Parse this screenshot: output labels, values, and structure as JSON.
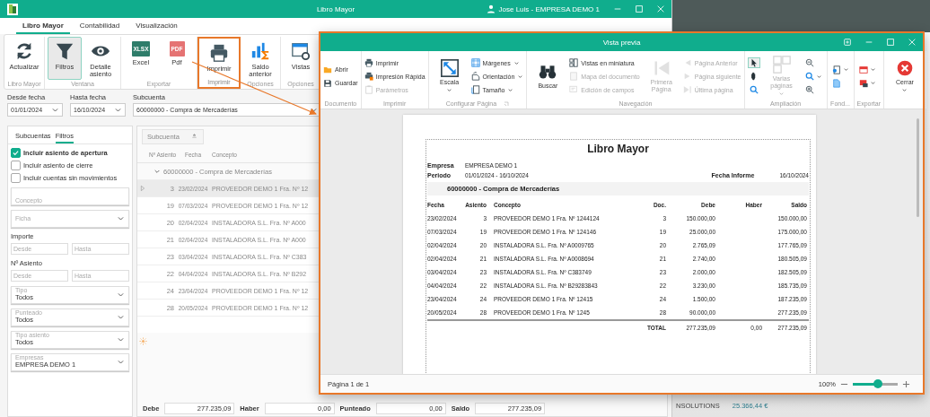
{
  "main_window": {
    "title": "Libro Mayor",
    "user": "Jose Luis - EMPRESA DEMO 1"
  },
  "ribbon_tabs": [
    {
      "label": "Libro Mayor",
      "selected": true
    },
    {
      "label": "Contabilidad",
      "selected": false
    },
    {
      "label": "Visualización",
      "selected": false
    }
  ],
  "ribbon_groups": [
    {
      "label": "Libro Mayor",
      "highlighted": false,
      "buttons": [
        {
          "label": "Actualizar",
          "selected": false
        }
      ]
    },
    {
      "label": "Ventana",
      "highlighted": false,
      "buttons": [
        {
          "label": "Filtros",
          "selected": true
        },
        {
          "label": "Detalle asiento",
          "selected": false
        }
      ]
    },
    {
      "label": "Exportar",
      "highlighted": false,
      "buttons": [
        {
          "label": "Excel",
          "selected": false,
          "badge": "XLSX"
        },
        {
          "label": "Pdf",
          "selected": false,
          "badge": "PDF"
        }
      ]
    },
    {
      "label": "Imprimir",
      "highlighted": true,
      "buttons": [
        {
          "label": "Imprimir",
          "selected": false
        }
      ]
    },
    {
      "label": "Opciones",
      "highlighted": false,
      "buttons": [
        {
          "label": "Saldo anterior",
          "selected": false
        }
      ]
    },
    {
      "label": "Opciones",
      "highlighted": false,
      "buttons": [
        {
          "label": "Vistas",
          "selected": false
        }
      ]
    }
  ],
  "filters": [
    {
      "label": "Desde fecha",
      "value": "01/01/2024"
    },
    {
      "label": "Hasta fecha",
      "value": "16/10/2024"
    },
    {
      "label": "Subcuenta",
      "value": "60000000 - Compra de Mercaderías"
    }
  ],
  "side_panel": {
    "tabs": [
      {
        "label": "Subcuentas",
        "selected": false
      },
      {
        "label": "Filtros",
        "selected": true
      }
    ],
    "checkboxes": [
      {
        "label": "Incluir asiento de apertura",
        "checked": true
      },
      {
        "label": "Incluir asiento de cierre",
        "checked": false
      },
      {
        "label": "Incluir cuentas sin movimientos",
        "checked": false
      }
    ],
    "fields": [
      {
        "kind": "text",
        "placeholder": "Concepto"
      },
      {
        "kind": "select",
        "placeholder": "Ficha"
      },
      {
        "kind": "range",
        "label": "Importe",
        "from_placeholder": "Desde",
        "to_placeholder": "Hasta"
      },
      {
        "kind": "range",
        "label": "Nº Asiento",
        "from_placeholder": "Desde",
        "to_placeholder": "Hasta"
      },
      {
        "kind": "select",
        "label": "Tipo",
        "value": "Todos"
      },
      {
        "kind": "select",
        "label": "Punteado",
        "value": "Todos"
      },
      {
        "kind": "select",
        "label": "Tipo asiento",
        "value": "Todos"
      },
      {
        "kind": "select",
        "label": "Empresas",
        "value": "EMPRESA DEMO 1"
      }
    ]
  },
  "grid": {
    "group_chip": "Subcuenta",
    "columns": [
      "Nº Asiento",
      "Fecha",
      "Concepto"
    ],
    "group_row": "60000000 - Compra de Mercaderías",
    "rows": [
      {
        "asiento": "3",
        "fecha": "23/02/2024",
        "concepto": "PROVEEDOR DEMO 1 Fra. Nº 12",
        "selected": true
      },
      {
        "asiento": "19",
        "fecha": "07/03/2024",
        "concepto": "PROVEEDOR DEMO 1 Fra. Nº 12",
        "selected": false
      },
      {
        "asiento": "20",
        "fecha": "02/04/2024",
        "concepto": "INSTALADORA S.L. Fra. Nº A000",
        "selected": false
      },
      {
        "asiento": "21",
        "fecha": "02/04/2024",
        "concepto": "INSTALADORA S.L. Fra. Nº A000",
        "selected": false
      },
      {
        "asiento": "23",
        "fecha": "03/04/2024",
        "concepto": "INSTALADORA S.L. Fra. Nº C383",
        "selected": false
      },
      {
        "asiento": "22",
        "fecha": "04/04/2024",
        "concepto": "INSTALADORA S.L. Fra. Nº B292",
        "selected": false
      },
      {
        "asiento": "24",
        "fecha": "23/04/2024",
        "concepto": "PROVEEDOR DEMO 1 Fra. Nº 12",
        "selected": false
      },
      {
        "asiento": "28",
        "fecha": "20/05/2024",
        "concepto": "PROVEEDOR DEMO 1 Fra. Nº 12",
        "selected": false
      }
    ],
    "totals": [
      {
        "label": "Debe",
        "value": "277.235,09"
      },
      {
        "label": "Haber",
        "value": "0,00"
      },
      {
        "label": "Punteado",
        "value": "0,00"
      },
      {
        "label": "Saldo",
        "value": "277.235,09"
      }
    ]
  },
  "background_list": [
    {
      "name": "NSOLUTIONS",
      "amount": "25.366,44 €"
    }
  ],
  "preview": {
    "title": "Vista previa",
    "ribbon_groups": [
      {
        "label": "Documento",
        "launcher": false,
        "columns": [
          [
            {
              "kind": "small",
              "label": "Abrir",
              "disabled": false
            },
            {
              "kind": "small",
              "label": "Guardar",
              "disabled": false
            }
          ]
        ]
      },
      {
        "label": "Imprimir",
        "launcher": false,
        "columns": [
          [
            {
              "kind": "small",
              "label": "Imprimir",
              "disabled": false
            },
            {
              "kind": "small",
              "label": "Impresión Rápida",
              "disabled": false
            },
            {
              "kind": "small",
              "label": "Parámetros",
              "disabled": true
            }
          ]
        ]
      },
      {
        "label": "Configurar Página",
        "launcher": true,
        "columns": [
          [
            {
              "kind": "large",
              "label": "Escala",
              "disabled": false,
              "caret": true
            }
          ],
          [
            {
              "kind": "small",
              "label": "Márgenes",
              "disabled": false,
              "caret": true
            },
            {
              "kind": "small",
              "label": "Orientación",
              "disabled": false,
              "caret": true
            },
            {
              "kind": "small",
              "label": "Tamaño",
              "disabled": false,
              "caret": true
            }
          ]
        ]
      },
      {
        "label": "Navegación",
        "launcher": false,
        "columns": [
          [
            {
              "kind": "large",
              "label": "Buscar",
              "disabled": false
            }
          ],
          [
            {
              "kind": "small",
              "label": "Vistas en miniatura",
              "disabled": false
            },
            {
              "kind": "small",
              "label": "Mapa del documento",
              "disabled": true
            },
            {
              "kind": "small",
              "label": "Edición de campos",
              "disabled": true
            }
          ],
          [
            {
              "kind": "large",
              "label": "Primera Página",
              "disabled": true
            }
          ],
          [
            {
              "kind": "small",
              "label": "Página Anterior",
              "disabled": true
            },
            {
              "kind": "small",
              "label": "Página siguiente",
              "disabled": true
            },
            {
              "kind": "small",
              "label": "Última página",
              "disabled": true
            }
          ]
        ]
      },
      {
        "label": "Ampliación",
        "launcher": false,
        "columns": [
          [
            {
              "kind": "icon",
              "disabled": false,
              "selected": true
            },
            {
              "kind": "icon",
              "disabled": false,
              "selected": false
            },
            {
              "kind": "icon",
              "disabled": false,
              "selected": false
            }
          ],
          [
            {
              "kind": "large",
              "label": "Varias páginas",
              "disabled": true,
              "caret": true
            }
          ],
          [
            {
              "kind": "icon",
              "disabled": false
            },
            {
              "kind": "icon",
              "disabled": false,
              "caret": true
            },
            {
              "kind": "icon",
              "disabled": false
            }
          ]
        ]
      },
      {
        "label": "Fond...",
        "launcher": false,
        "columns": [
          [
            {
              "kind": "icon",
              "disabled": false,
              "caret": true
            },
            {
              "kind": "icon",
              "disabled": false
            }
          ]
        ]
      },
      {
        "label": "Exportar",
        "launcher": false,
        "columns": [
          [
            {
              "kind": "icon",
              "disabled": false,
              "caret": true
            },
            {
              "kind": "icon",
              "disabled": false,
              "caret": true
            }
          ]
        ]
      },
      {
        "columns": [
          [
            {
              "kind": "large",
              "label": "Cerrar",
              "disabled": false,
              "caret": true
            }
          ]
        ]
      }
    ],
    "report": {
      "title": "Libro Mayor",
      "meta": [
        {
          "label": "Empresa",
          "value": "EMPRESA DEMO 1"
        },
        {
          "label": "Periodo",
          "value": "01/01/2024 - 16/10/2024"
        }
      ],
      "date_label": "Fecha Informe",
      "date_value": "16/10/2024",
      "group": "60000000 - Compra de Mercaderías",
      "columns": [
        "Fecha",
        "Asiento",
        "Concepto",
        "Doc.",
        "Debe",
        "Haber",
        "Saldo"
      ],
      "rows": [
        [
          "23/02/2024",
          "3",
          "PROVEEDOR DEMO 1 Fra. Nº 1244124",
          "3",
          "150.000,00",
          "",
          "150.000,00"
        ],
        [
          "07/03/2024",
          "19",
          "PROVEEDOR DEMO 1 Fra. Nº 124146",
          "19",
          "25.000,00",
          "",
          "175.000,00"
        ],
        [
          "02/04/2024",
          "20",
          "INSTALADORA S.L. Fra. Nº A0009765",
          "20",
          "2.765,09",
          "",
          "177.765,09"
        ],
        [
          "02/04/2024",
          "21",
          "INSTALADORA S.L. Fra. Nº A0008694",
          "21",
          "2.740,00",
          "",
          "180.505,09"
        ],
        [
          "03/04/2024",
          "23",
          "INSTALADORA S.L. Fra. Nº C383749",
          "23",
          "2.000,00",
          "",
          "182.505,09"
        ],
        [
          "04/04/2024",
          "22",
          "INSTALADORA S.L. Fra. Nº B29283843",
          "22",
          "3.230,00",
          "",
          "185.735,09"
        ],
        [
          "23/04/2024",
          "24",
          "PROVEEDOR DEMO 1 Fra. Nº 12415",
          "24",
          "1.500,00",
          "",
          "187.235,09"
        ],
        [
          "20/05/2024",
          "28",
          "PROVEEDOR DEMO 1 Fra. Nº 1245",
          "28",
          "90.000,00",
          "",
          "277.235,09"
        ]
      ],
      "total": [
        "TOTAL",
        "277.235,09",
        "0,00",
        "277.235,09"
      ]
    },
    "status": "Página 1 de 1",
    "zoom": {
      "reading": "100%",
      "level": 0.55
    }
  }
}
